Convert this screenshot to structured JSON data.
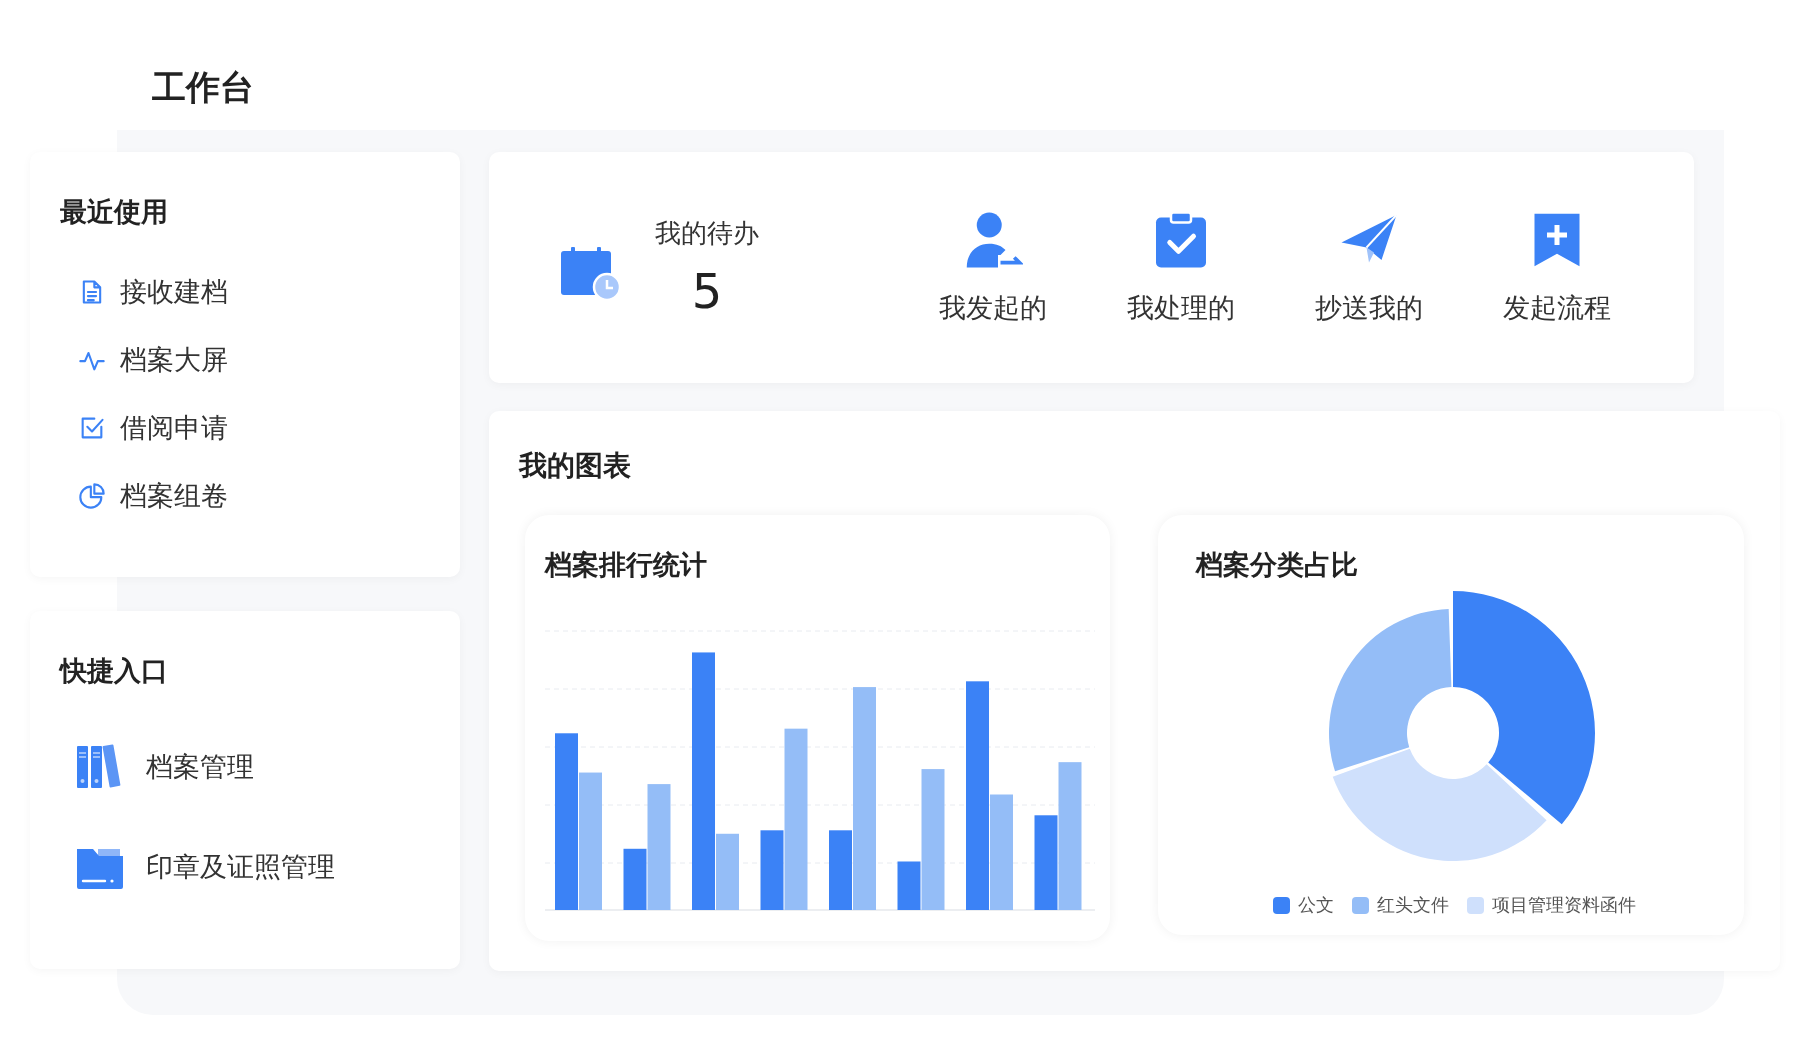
{
  "page_title": "工作台",
  "recent": {
    "title": "最近使用",
    "items": [
      {
        "label": "接收建档"
      },
      {
        "label": "档案大屏"
      },
      {
        "label": "借阅申请"
      },
      {
        "label": "档案组卷"
      }
    ]
  },
  "shortcuts": {
    "title": "快捷入口",
    "items": [
      {
        "label": "档案管理"
      },
      {
        "label": "印章及证照管理"
      }
    ]
  },
  "todo": {
    "label": "我的待办",
    "count": "5"
  },
  "actions": [
    {
      "label": "我发起的"
    },
    {
      "label": "我处理的"
    },
    {
      "label": "抄送我的"
    },
    {
      "label": "发起流程"
    }
  ],
  "charts": {
    "title": "我的图表",
    "bar_panel": {
      "title": "档案排行统计"
    },
    "donut_panel": {
      "title": "档案分类占比",
      "legend": [
        {
          "label": "公文",
          "color": "#3b82f6"
        },
        {
          "label": "红头文件",
          "color": "#94bdf7"
        },
        {
          "label": "项目管理资料函件",
          "color": "#cfe0fc"
        }
      ]
    }
  }
}
